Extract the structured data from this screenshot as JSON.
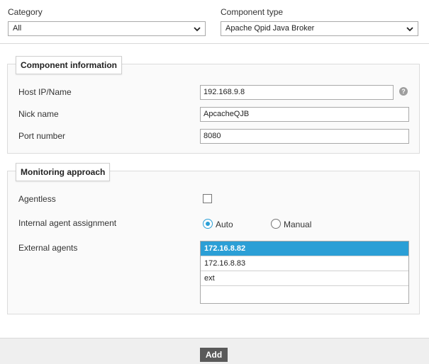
{
  "filters": {
    "category_label": "Category",
    "category_value": "All",
    "component_type_label": "Component type",
    "component_type_value": "Apache Qpid Java Broker"
  },
  "component_info": {
    "legend": "Component information",
    "host_label": "Host IP/Name",
    "host_value": "192.168.9.8",
    "help_glyph": "?",
    "nick_label": "Nick name",
    "nick_value": "ApcacheQJB",
    "port_label": "Port number",
    "port_value": "8080"
  },
  "monitoring": {
    "legend": "Monitoring approach",
    "agentless_label": "Agentless",
    "agentless_checked": false,
    "assignment_label": "Internal agent assignment",
    "assignment_options": [
      "Auto",
      "Manual"
    ],
    "assignment_selected": "Auto",
    "external_label": "External agents",
    "external_agents": [
      "172.16.8.82",
      "172.16.8.83",
      "ext"
    ],
    "external_selected": "172.16.8.82"
  },
  "footer": {
    "add_label": "Add"
  },
  "colors": {
    "accent": "#2b9fd6",
    "button": "#5a5a5a",
    "footer_bg": "#efefef"
  },
  "icons": {
    "dropdown": "chevron-down-icon",
    "help": "help-icon"
  }
}
